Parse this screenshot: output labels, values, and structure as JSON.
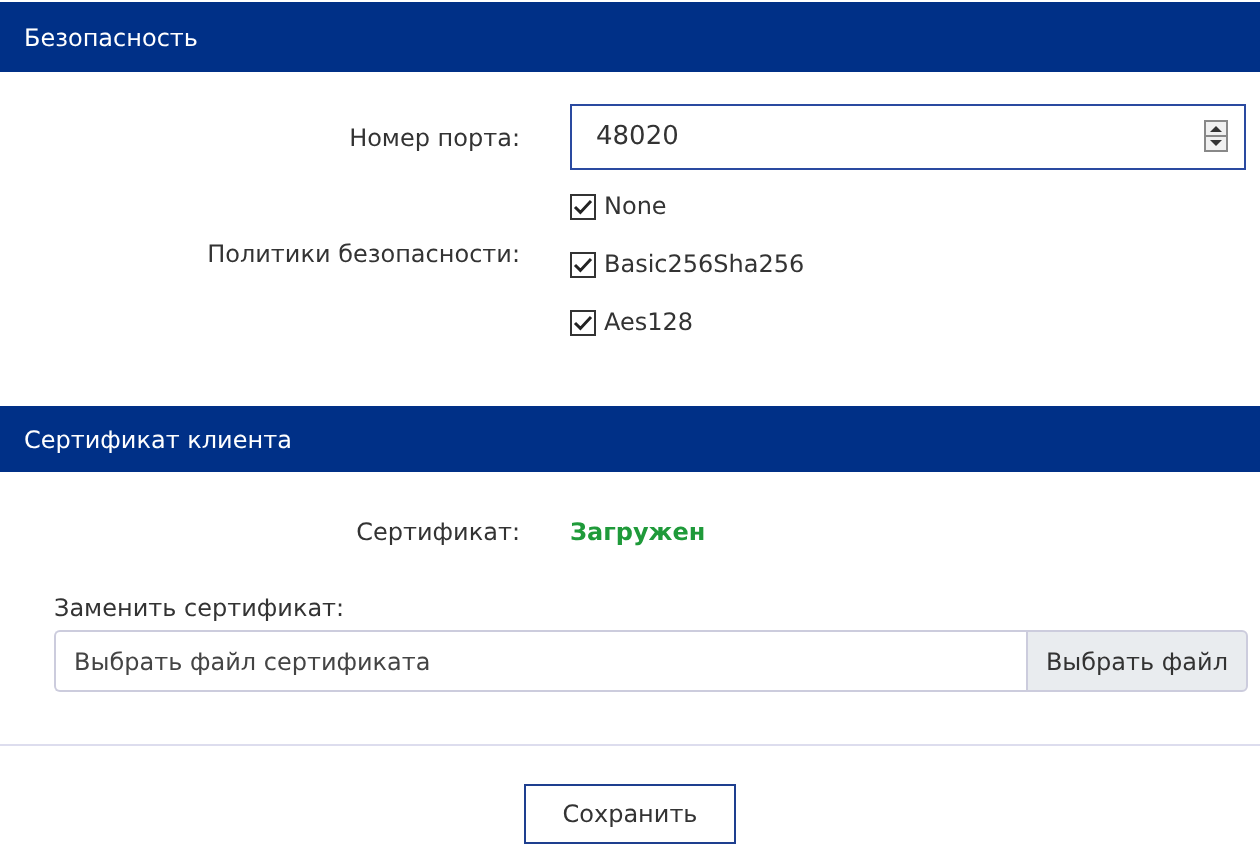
{
  "sections": [
    {
      "title": "Безопасность",
      "port": {
        "label": "Номер порта:",
        "value": "48020"
      },
      "policies": {
        "label": "Политики безопасности:",
        "items": [
          {
            "label": "None",
            "checked": true
          },
          {
            "label": "Basic256Sha256",
            "checked": true
          },
          {
            "label": "Aes128",
            "checked": true
          }
        ]
      }
    },
    {
      "title": "Сертификат клиента",
      "certificate": {
        "label": "Сертификат:",
        "status": "Загружен"
      },
      "replace": {
        "label": "Заменить сертификат:",
        "placeholder": "Выбрать файл сертификата",
        "button": "Выбрать файл"
      }
    }
  ],
  "save_button": "Сохранить"
}
